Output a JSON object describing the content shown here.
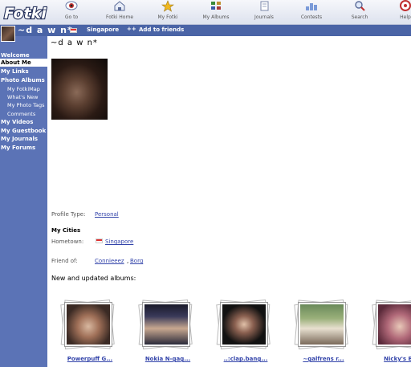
{
  "nav": {
    "logo_text": "Fotki",
    "items": [
      {
        "label": "Go to",
        "icon": "eye-icon"
      },
      {
        "label": "Fotki Home",
        "icon": "house-icon"
      },
      {
        "label": "My Fotki",
        "icon": "star-icon"
      },
      {
        "label": "My Albums",
        "icon": "albums-icon"
      },
      {
        "label": "Journals",
        "icon": "journal-icon"
      },
      {
        "label": "Contests",
        "icon": "contests-icon"
      },
      {
        "label": "Search",
        "icon": "search-icon"
      },
      {
        "label": "Help",
        "icon": "help-icon"
      }
    ]
  },
  "profile": {
    "name": "~d a w n*",
    "city": "Singapore",
    "add_friend_icon": "++",
    "add_friends": "Add to friends"
  },
  "sidebar": {
    "items": [
      {
        "label": "Welcome",
        "type": "main"
      },
      {
        "label": "About Me",
        "type": "main",
        "active": true
      },
      {
        "label": "My Links",
        "type": "main"
      },
      {
        "label": "Photo Albums",
        "type": "main"
      },
      {
        "label": "My FotkiMap",
        "type": "sub"
      },
      {
        "label": "What's New",
        "type": "sub"
      },
      {
        "label": "My Photo Tags",
        "type": "sub"
      },
      {
        "label": "Comments",
        "type": "sub"
      },
      {
        "label": "My Videos",
        "type": "main"
      },
      {
        "label": "My Guestbook",
        "type": "main"
      },
      {
        "label": "My Journals",
        "type": "main"
      },
      {
        "label": "My Forums",
        "type": "main"
      }
    ]
  },
  "main": {
    "title": "~d a w n*",
    "profile_type_label": "Profile Type:",
    "profile_type_value": "Personal",
    "my_cities_label": "My Cities",
    "hometown_label": "Hometown:",
    "hometown_value": "Singapore",
    "friend_of_label": "Friend of:",
    "friends": [
      "Connieeez",
      "Borg"
    ],
    "albums_heading": "New and updated albums:",
    "albums": [
      {
        "caption": "Powerpuff G..."
      },
      {
        "caption": "Nokia N-gag..."
      },
      {
        "caption": "..:clap.bang..."
      },
      {
        "caption": "~galfrens r..."
      },
      {
        "caption": "Nicky's B..."
      }
    ]
  },
  "colors": {
    "sidebar_bg": "#5b73b6",
    "header_bar": "#4a64a6",
    "link": "#3344aa"
  }
}
